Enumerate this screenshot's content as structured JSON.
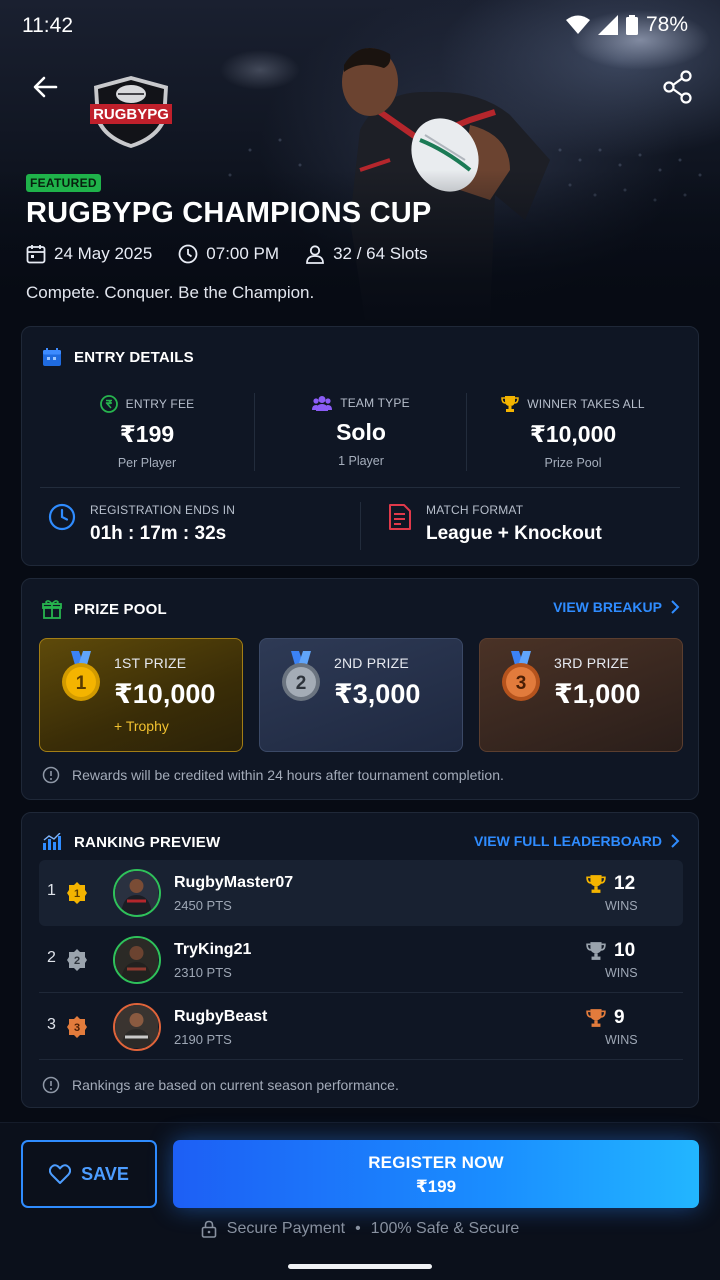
{
  "status_bar": {
    "time": "11:42",
    "battery": "78%"
  },
  "hero": {
    "logo_text": "RUGBYPG",
    "badge": "FEATURED",
    "title": "RUGBYPG CHAMPIONS CUP",
    "date": "24 May 2025",
    "time": "07:00 PM",
    "slots": "32 / 64 Slots",
    "tagline": "Compete. Conquer. Be the Champion."
  },
  "entry_details": {
    "heading": "ENTRY DETAILS",
    "fee": {
      "label": "ENTRY FEE",
      "value": "₹199",
      "sub": "Per Player"
    },
    "team": {
      "label": "TEAM TYPE",
      "value": "Solo",
      "sub": "1 Player"
    },
    "winner": {
      "label": "WINNER TAKES ALL",
      "value": "₹10,000",
      "sub": "Prize Pool"
    },
    "registration": {
      "label": "REGISTRATION ENDS IN",
      "value": "01h : 17m : 32s"
    },
    "format": {
      "label": "MATCH FORMAT",
      "value": "League + Knockout"
    }
  },
  "prize_pool": {
    "heading": "PRIZE POOL",
    "link": "VIEW BREAKUP",
    "prizes": [
      {
        "medal": "1",
        "rank": "1ST PRIZE",
        "amount": "₹10,000",
        "extra": "+ Trophy",
        "color": "#f4b400"
      },
      {
        "medal": "2",
        "rank": "2ND PRIZE",
        "amount": "₹3,000",
        "color": "#9aa3ad"
      },
      {
        "medal": "3",
        "rank": "3RD PRIZE",
        "amount": "₹1,000",
        "color": "#e27b3c"
      }
    ],
    "note": "Rewards will be credited within 24 hours after tournament completion."
  },
  "ranking": {
    "heading": "RANKING PREVIEW",
    "link": "VIEW FULL LEADERBOARD",
    "wins_label": "WINS",
    "rows": [
      {
        "position": "1",
        "name": "RugbyMaster07",
        "points": "2450 PTS",
        "wins": "12"
      },
      {
        "position": "2",
        "name": "TryKing21",
        "points": "2310 PTS",
        "wins": "10"
      },
      {
        "position": "3",
        "name": "RugbyBeast",
        "points": "2190 PTS",
        "wins": "9"
      }
    ],
    "note": "Rankings are based on current season performance."
  },
  "actions": {
    "save": "SAVE",
    "register_label": "REGISTER NOW",
    "register_price": "₹199",
    "secure_1": "Secure Payment",
    "secure_dot": "•",
    "secure_2": "100% Safe & Secure"
  },
  "colors": {
    "accent": "#2f8cff",
    "gold": "#f4b400",
    "silver": "#9aa3ad",
    "bronze": "#e27b3c",
    "green": "#1fb24a"
  }
}
